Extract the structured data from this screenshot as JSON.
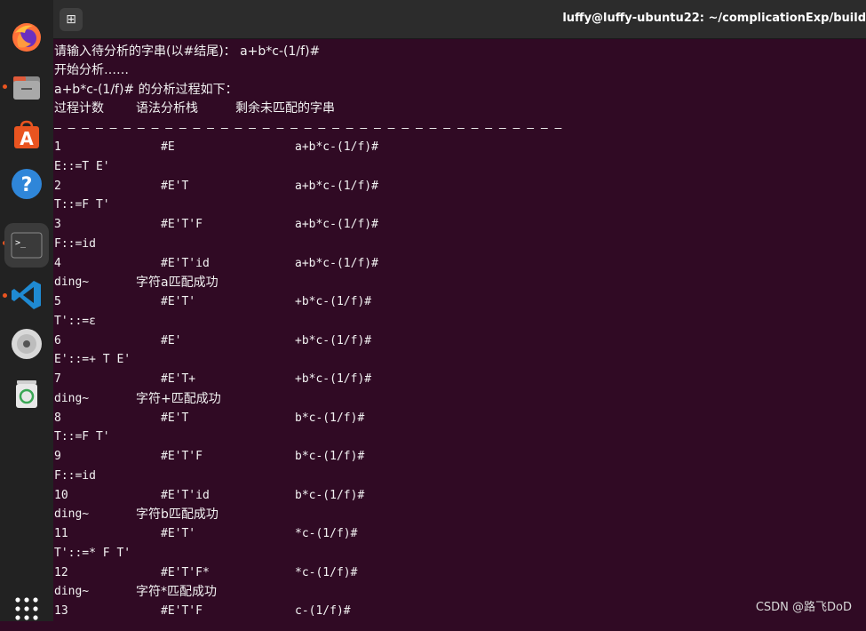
{
  "window": {
    "title": "luffy@luffy-ubuntu22: ~/complicationExp/build",
    "new_tab_glyph": "⊞"
  },
  "dock": {
    "apps": [
      "firefox-icon",
      "files-icon",
      "app-center-icon",
      "help-icon",
      "terminal-icon",
      "vscode-icon",
      "disc-icon",
      "trash-icon",
      "app-grid-icon"
    ],
    "accent_color": "#e95420"
  },
  "terminal": {
    "prompt_line": "请输入待分析的字串(以#结尾)： a+b*c-(1/f)#",
    "start_line": "开始分析……",
    "process_line": "a+b*c-(1/f)# 的分析过程如下：",
    "header": {
      "count": "过程计数",
      "stack": "语法分析栈",
      "remaining": "剩余未匹配的字串"
    },
    "separator": "— — — — — — — — — — — — — — — — — — — — — — — — — — — — — — — — — — — — —",
    "rows": [
      {
        "kind": "step",
        "count": "1",
        "stack": "#E",
        "rest": "a+b*c-(1/f)#"
      },
      {
        "kind": "prod",
        "text": "E::=T E'"
      },
      {
        "kind": "step",
        "count": "2",
        "stack": "#E'T",
        "rest": "a+b*c-(1/f)#"
      },
      {
        "kind": "prod",
        "text": "T::=F T'"
      },
      {
        "kind": "step",
        "count": "3",
        "stack": "#E'T'F",
        "rest": "a+b*c-(1/f)#"
      },
      {
        "kind": "prod",
        "text": "F::=id"
      },
      {
        "kind": "step",
        "count": "4",
        "stack": "#E'T'id",
        "rest": "a+b*c-(1/f)#"
      },
      {
        "kind": "match",
        "ding": "ding~",
        "msg": "字符a匹配成功"
      },
      {
        "kind": "step",
        "count": "5",
        "stack": "#E'T'",
        "rest": "+b*c-(1/f)#"
      },
      {
        "kind": "prod",
        "text": "T'::=ε"
      },
      {
        "kind": "step",
        "count": "6",
        "stack": "#E'",
        "rest": "+b*c-(1/f)#"
      },
      {
        "kind": "prod",
        "text": "E'::=+ T E'"
      },
      {
        "kind": "step",
        "count": "7",
        "stack": "#E'T+",
        "rest": "+b*c-(1/f)#"
      },
      {
        "kind": "match",
        "ding": "ding~",
        "msg": "字符+匹配成功"
      },
      {
        "kind": "step",
        "count": "8",
        "stack": "#E'T",
        "rest": "b*c-(1/f)#"
      },
      {
        "kind": "prod",
        "text": "T::=F T'"
      },
      {
        "kind": "step",
        "count": "9",
        "stack": "#E'T'F",
        "rest": "b*c-(1/f)#"
      },
      {
        "kind": "prod",
        "text": "F::=id"
      },
      {
        "kind": "step",
        "count": "10",
        "stack": "#E'T'id",
        "rest": "b*c-(1/f)#"
      },
      {
        "kind": "match",
        "ding": "ding~",
        "msg": "字符b匹配成功"
      },
      {
        "kind": "step",
        "count": "11",
        "stack": "#E'T'",
        "rest": "*c-(1/f)#"
      },
      {
        "kind": "prod",
        "text": "T'::=* F T'"
      },
      {
        "kind": "step",
        "count": "12",
        "stack": "#E'T'F*",
        "rest": "*c-(1/f)#"
      },
      {
        "kind": "match",
        "ding": "ding~",
        "msg": "字符*匹配成功"
      },
      {
        "kind": "step",
        "count": "13",
        "stack": "#E'T'F",
        "rest": "c-(1/f)#"
      }
    ]
  },
  "watermark": "CSDN @路飞DoD"
}
